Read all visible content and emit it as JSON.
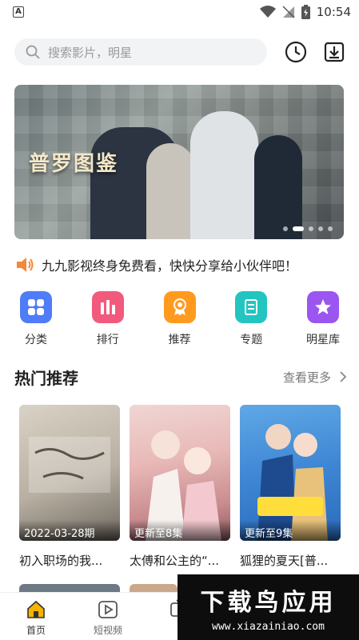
{
  "status": {
    "time": "10:54",
    "left_badge": "A"
  },
  "search": {
    "placeholder": "搜索影片，明星"
  },
  "icons": {
    "search": "search-icon",
    "history": "clock-icon",
    "download": "download-icon",
    "speaker": "speaker-icon",
    "chevron": "chevron-right-icon"
  },
  "banner": {
    "title": "普罗图鉴",
    "dot_count": 5,
    "active_dot": 1
  },
  "notice": {
    "text": "九九影视终身免费看，快快分享给小伙伴吧！"
  },
  "categories": [
    {
      "label": "分类",
      "icon": "grid-icon",
      "color": "#4f7cf7"
    },
    {
      "label": "排行",
      "icon": "ranking-icon",
      "color": "#f25a7d"
    },
    {
      "label": "推荐",
      "icon": "award-icon",
      "color": "#ff9a1f"
    },
    {
      "label": "专题",
      "icon": "document-icon",
      "color": "#22c5c0"
    },
    {
      "label": "明星库",
      "icon": "star-icon",
      "color": "#9b55f0"
    }
  ],
  "section": {
    "title": "热门推荐",
    "more": "查看更多"
  },
  "cards": [
    {
      "tag": "2022-03-28期",
      "name": "初入职场的我..."
    },
    {
      "tag": "更新至8集",
      "name": "太傅和公主的“..."
    },
    {
      "tag": "更新至9集",
      "name": "狐狸的夏天[普..."
    }
  ],
  "tabs": [
    {
      "label": "首页",
      "icon": "home-icon"
    },
    {
      "label": "短视频",
      "icon": "play-icon"
    },
    {
      "label": "",
      "icon": "tv-icon"
    }
  ],
  "watermark": {
    "big": "下载鸟应用",
    "small": "www.xiazainiao.com"
  }
}
